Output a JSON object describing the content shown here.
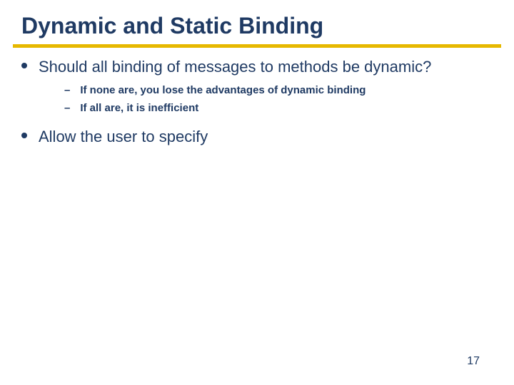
{
  "title": "Dynamic and Static Binding",
  "bullets": [
    {
      "text": "Should all binding of messages to methods be dynamic?",
      "sub": [
        "If none are, you lose the advantages of dynamic binding",
        "If all are, it is inefficient"
      ]
    },
    {
      "text": "Allow the user to specify",
      "sub": []
    }
  ],
  "page_number": "17"
}
